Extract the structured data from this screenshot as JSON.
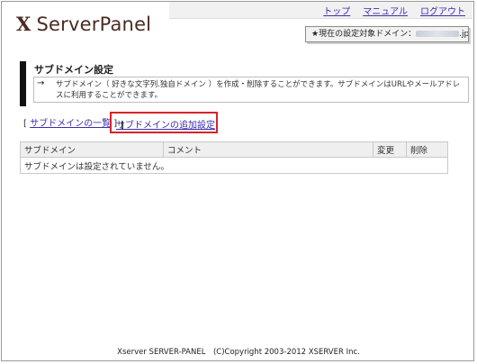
{
  "header": {
    "logo_mark": "X",
    "logo_text": "ServerPanel",
    "nav": [
      "トップ",
      "マニュアル",
      "ログアウト"
    ],
    "domain_label": "★現在の設定対象ドメイン：",
    "domain_suffix": ".jp"
  },
  "section": {
    "title": "サブドメイン設定",
    "arrow": "→",
    "description": "サブドメイン（ 好きな文字列.独自ドメイン ）を作成・削除することができます。サブドメインはURLやメールアドレスに利用することができます。"
  },
  "links": {
    "list_label": "サブドメインの一覧",
    "add_label": "サブドメインの追加設定",
    "bracket_open": "[",
    "bracket_close": "]"
  },
  "table": {
    "headers": [
      "サブドメイン",
      "コメント",
      "変更",
      "削除"
    ],
    "empty_message": "サブドメインは設定されていません。"
  },
  "footer": {
    "text": "Xserver SERVER-PANEL　(C)Copyright 2003-2012 XSERVER Inc."
  },
  "colors": {
    "highlight": "#d6232a",
    "link": "#3a2eae",
    "logo": "#4a2c22"
  }
}
